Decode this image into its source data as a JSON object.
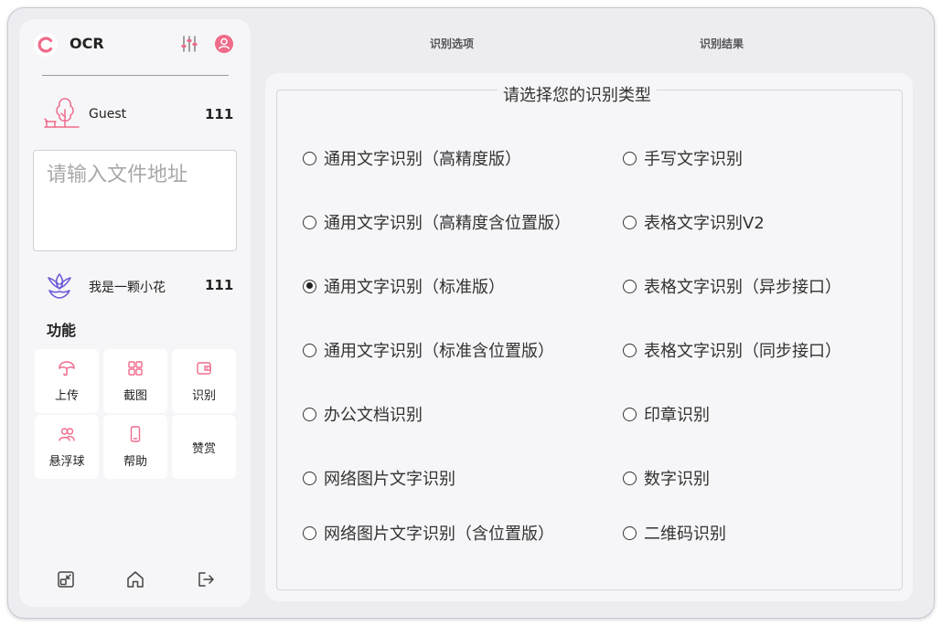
{
  "app": {
    "title": "OCR"
  },
  "tabs": [
    {
      "label": "识别选项"
    },
    {
      "label": "识别结果"
    }
  ],
  "sidebar": {
    "guest": {
      "name": "Guest",
      "count": "111"
    },
    "file_input": {
      "placeholder": "请输入文件地址",
      "value": ""
    },
    "flower": {
      "name": "我是一颗小花",
      "count": "111"
    },
    "functions_heading": "功能",
    "functions": [
      {
        "label": "上传",
        "icon": "umbrella-icon"
      },
      {
        "label": "截图",
        "icon": "screenshot-icon"
      },
      {
        "label": "识别",
        "icon": "wallet-icon"
      },
      {
        "label": "悬浮球",
        "icon": "users-icon"
      },
      {
        "label": "帮助",
        "icon": "phone-icon"
      },
      {
        "label": "赞赏",
        "icon": ""
      }
    ],
    "bottom_icons": [
      "shrink-icon",
      "home-icon",
      "logout-icon"
    ]
  },
  "main": {
    "legend": "请选择您的识别类型",
    "selected": "通用文字识别（标准版）",
    "options_left": [
      "通用文字识别（高精度版）",
      "通用文字识别（高精度含位置版）",
      "通用文字识别（标准版）",
      "通用文字识别（标准含位置版）",
      "办公文档识别",
      "网络图片文字识别",
      "网络图片文字识别（含位置版）"
    ],
    "options_right": [
      "手写文字识别",
      "表格文字识别V2",
      "表格文字识别（异步接口）",
      "表格文字识别（同步接口）",
      "印章识别",
      "数字识别",
      "二维码识别"
    ]
  },
  "colors": {
    "accent_pink": "#f06b8b",
    "accent_purple": "#6b5bd6",
    "window_bg": "#ececf1",
    "panel_bg": "#f6f6f8"
  }
}
